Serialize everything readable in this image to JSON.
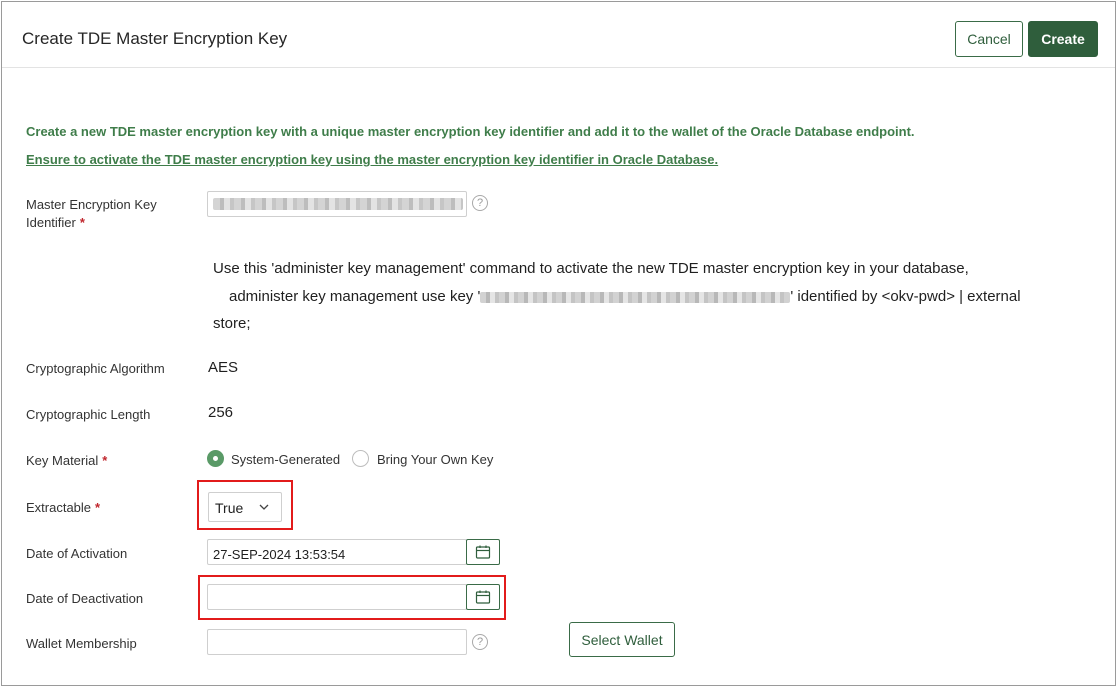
{
  "header": {
    "title": "Create TDE Master Encryption Key",
    "cancel_label": "Cancel",
    "create_label": "Create"
  },
  "intro": {
    "line1": "Create a new TDE master encryption key with a unique master encryption key identifier and add it to the wallet of the Oracle Database endpoint.",
    "line2": "Ensure to activate the TDE master encryption key using the master encryption key identifier in Oracle Database."
  },
  "form": {
    "identifier": {
      "label_line1": "Master Encryption Key",
      "label_line2": "Identifier",
      "required_mark": "*",
      "help": "?"
    },
    "command": {
      "line1": "Use this 'administer key management' command to activate the new TDE master encryption key in your database,",
      "line2_prefix": "administer key management use key '",
      "line2_suffix": "' identified by <okv-pwd> | external",
      "line3": "store;"
    },
    "algorithm": {
      "label": "Cryptographic Algorithm",
      "value": "AES"
    },
    "length": {
      "label": "Cryptographic Length",
      "value": "256"
    },
    "key_material": {
      "label": "Key Material",
      "required_mark": "*",
      "options": [
        "System-Generated",
        "Bring Your Own Key"
      ],
      "selected": "System-Generated"
    },
    "extractable": {
      "label": "Extractable",
      "required_mark": "*",
      "value": "True"
    },
    "activation": {
      "label": "Date of Activation",
      "value": "27-SEP-2024 13:53:54"
    },
    "deactivation": {
      "label": "Date of Deactivation",
      "value": ""
    },
    "wallet": {
      "label": "Wallet Membership",
      "value": "",
      "help": "?",
      "select_label": "Select Wallet"
    }
  },
  "colors": {
    "brand_green": "#2f5e3c",
    "intro_green": "#3f7d4a",
    "highlight_red": "#e21b1b",
    "required_red": "#c0262d"
  }
}
